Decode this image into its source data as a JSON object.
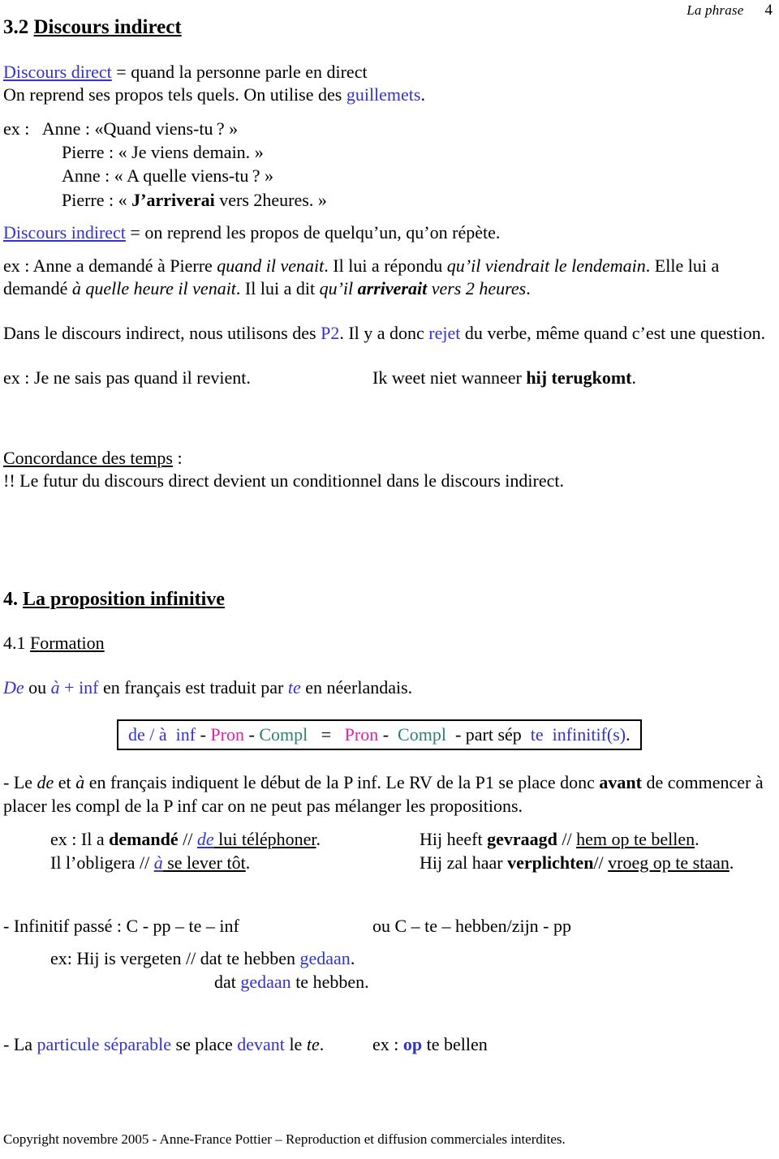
{
  "header": {
    "title": "La phrase",
    "page_number": "4"
  },
  "section_32": {
    "number": "3.2",
    "title": "Discours indirect"
  },
  "direct": {
    "term": "Discours direct",
    "definition": "=  quand la personne parle en direct",
    "line2_a": "On reprend ses propos tels quels. On utilise des ",
    "line2_keyword": "guillemets",
    "line2_b": "."
  },
  "dialogue": {
    "ex_label": "ex :",
    "lines": [
      {
        "speaker": "Anne : ",
        "open": "«",
        "text": "Quand viens-tu ? ",
        "bold": "",
        "close": "»"
      },
      {
        "speaker": "Pierre : ",
        "open": "« ",
        "text": "Je viens demain. ",
        "bold": "",
        "close": "»"
      },
      {
        "speaker": "Anne : ",
        "open": "« ",
        "text": "A quelle viens-tu ? ",
        "bold": "",
        "close": "»"
      },
      {
        "speaker": "Pierre : ",
        "open": "« ",
        "bold": "J’arriverai",
        "text": " vers 2heures. ",
        "close": "»"
      }
    ]
  },
  "indirect": {
    "term": "Discours indirect",
    "definition": "= on reprend les propos de quelqu’un, qu’on répète.",
    "example_parts": [
      {
        "text": "ex : Anne a demandé à Pierre ",
        "style": "normal"
      },
      {
        "text": "quand il venait",
        "style": "italic"
      },
      {
        "text": ". Il lui a répondu ",
        "style": "normal"
      },
      {
        "text": "qu’il viendrait le lendemain",
        "style": "italic"
      },
      {
        "text": ". Elle lui a demandé ",
        "style": "normal"
      },
      {
        "text": "à quelle heure il venait",
        "style": "italic"
      },
      {
        "text": ". Il lui a dit ",
        "style": "normal"
      },
      {
        "text": "qu’il ",
        "style": "italic"
      },
      {
        "text": "arriverait",
        "style": "bold-italic"
      },
      {
        "text": " vers 2 heures",
        "style": "italic"
      },
      {
        "text": ".",
        "style": "normal"
      }
    ],
    "rule_a": "Dans le discours indirect, nous utilisons des ",
    "rule_kw1": "P2",
    "rule_b": ". Il y a donc ",
    "rule_kw2": "rejet",
    "rule_c": " du verbe, même quand c’est une question.",
    "ex_fr": "ex : Je ne sais pas quand il revient.",
    "ex_nl_a": "Ik weet niet wanneer ",
    "ex_nl_bold": "hij terugkomt",
    "ex_nl_b": "."
  },
  "concordance": {
    "title": "Concordance des temps",
    "colon": " :",
    "rule": "!! Le futur du discours direct devient un conditionnel dans le discours indirect."
  },
  "section_4": {
    "number": "4.",
    "title": "La proposition infinitive",
    "sub_number": "4.1",
    "sub_title": "Formation",
    "intro": {
      "p1": "De",
      "p2": " ou ",
      "p3": "à",
      "p4": " + inf",
      "p5": " en français est traduit par ",
      "p6": "te",
      "p7": " en néerlandais."
    },
    "formula": {
      "left_blue": "de / à  inf",
      "dash1": " - ",
      "pron1": "Pron",
      "dash2": " - ",
      "compl1": "Compl",
      "equals": "   =   ",
      "pron2": "Pron",
      "dash3": " - ",
      "compl2": " Compl ",
      "dash4": " - ",
      "part_sep": "part sép",
      "te_inf": "  te  infinitif(s)",
      "period": "."
    },
    "rule_parts": [
      {
        "text": "- Le ",
        "style": "normal"
      },
      {
        "text": "de",
        "style": "italic"
      },
      {
        "text": " et ",
        "style": "normal"
      },
      {
        "text": "à",
        "style": "italic"
      },
      {
        "text": " en français indiquent le début de la P inf. Le RV de la P1 se place donc ",
        "style": "normal"
      },
      {
        "text": "avant",
        "style": "bold"
      },
      {
        "text": " de commencer à placer les compl de la P inf car on ne peut pas mélanger les propositions.",
        "style": "normal"
      }
    ],
    "examples": [
      {
        "fr_pre": "ex : Il a ",
        "fr_bold": "demandé",
        "fr_mid": " // ",
        "fr_blue": "de",
        "fr_post": " lui téléphoner",
        "fr_end": ".",
        "nl_pre": "Hij heeft ",
        "nl_bold": "gevraagd",
        "nl_mid": " //  ",
        "nl_under": "hem op te bellen",
        "nl_end": "."
      },
      {
        "fr_pre": "Il l’obligera ",
        "fr_bold": "",
        "fr_mid": "// ",
        "fr_blue": "à",
        "fr_post": " se lever tôt",
        "fr_end": ".",
        "nl_pre": "Hij zal haar ",
        "nl_bold": "verplichten",
        "nl_mid": "// ",
        "nl_under": "vroeg op te staan",
        "nl_end": "."
      }
    ],
    "infinitif_passe": {
      "label": "- Infinitif passé :  C  - pp – te – inf",
      "alt": "ou   C – te – hebben/zijn  - pp",
      "ex_line1_pre": "ex: Hij is vergeten  // dat  te hebben ",
      "ex_line1_blue": "gedaan",
      "ex_line1_end": ".",
      "ex_line2_pre": "dat ",
      "ex_line2_blue": "gedaan",
      "ex_line2_end": " te hebben."
    },
    "particule": {
      "pre": "- La ",
      "kw1": "particule séparable",
      "mid": " se place ",
      "kw2": "devant",
      "post": " le ",
      "te": "te",
      "end": ".",
      "ex_pre": "ex : ",
      "ex_bold": "op",
      "ex_post": " te bellen"
    }
  },
  "footer": {
    "text": "Copyright novembre 2005 - Anne-France Pottier – Reproduction et diffusion commerciales interdites."
  }
}
